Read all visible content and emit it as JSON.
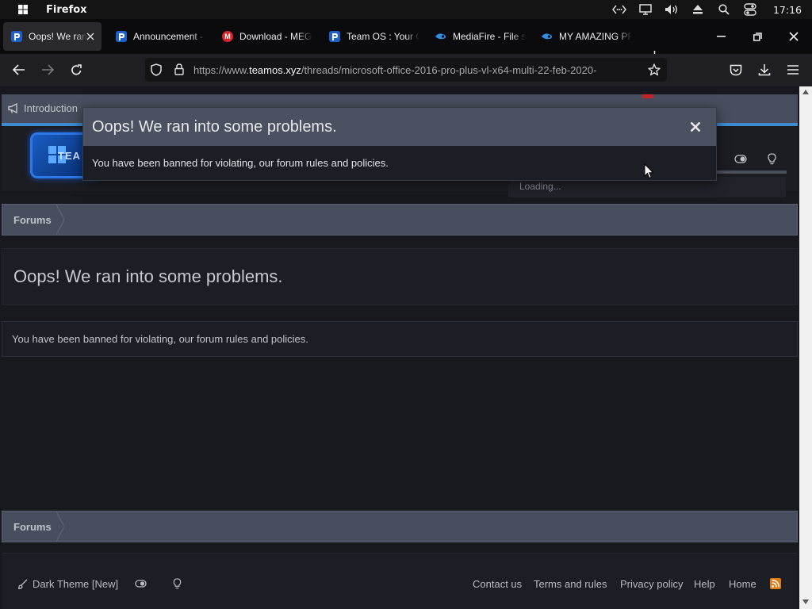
{
  "taskbar": {
    "app_name": "Firefox",
    "clock": "17:16"
  },
  "tabs": [
    {
      "label": "Oops! We ran into some problems.",
      "favicon": "teamos-favicon",
      "active": true
    },
    {
      "label": "Announcement - TeamOS",
      "favicon": "teamos-favicon"
    },
    {
      "label": "Download - MEGA",
      "favicon": "mega-favicon"
    },
    {
      "label": "Team OS : Your Only Destination",
      "favicon": "teamos-favicon"
    },
    {
      "label": "MediaFire - File sharing",
      "favicon": "mediafire-favicon"
    },
    {
      "label": "MY AMAZING PROGRAMS",
      "favicon": "mediafire-favicon"
    }
  ],
  "navbar": {
    "url_prefix": "https://www.",
    "url_domain": "teamos.xyz",
    "url_path": "/threads/microsoft-office-2016-pro-plus-vl-x64-multi-22-feb-2020-"
  },
  "forum": {
    "topnav_first": "Introduction",
    "loading": "Loading...",
    "breadcrumb": "Forums",
    "page_title": "Oops! We ran into some problems.",
    "message": "You have been banned for violating, our forum rules and policies."
  },
  "modal": {
    "title": "Oops! We ran into some problems.",
    "message": "You have been banned for violating, our forum rules and policies."
  },
  "footer": {
    "theme": "Dark Theme [New]",
    "links": [
      "Contact us",
      "Terms and rules",
      "Privacy policy",
      "Help",
      "Home"
    ]
  },
  "colors": {
    "accent": "#3e8bd2",
    "header_bg": "#484e5d",
    "page_bg": "#17191f",
    "rss": "#e07b12"
  }
}
